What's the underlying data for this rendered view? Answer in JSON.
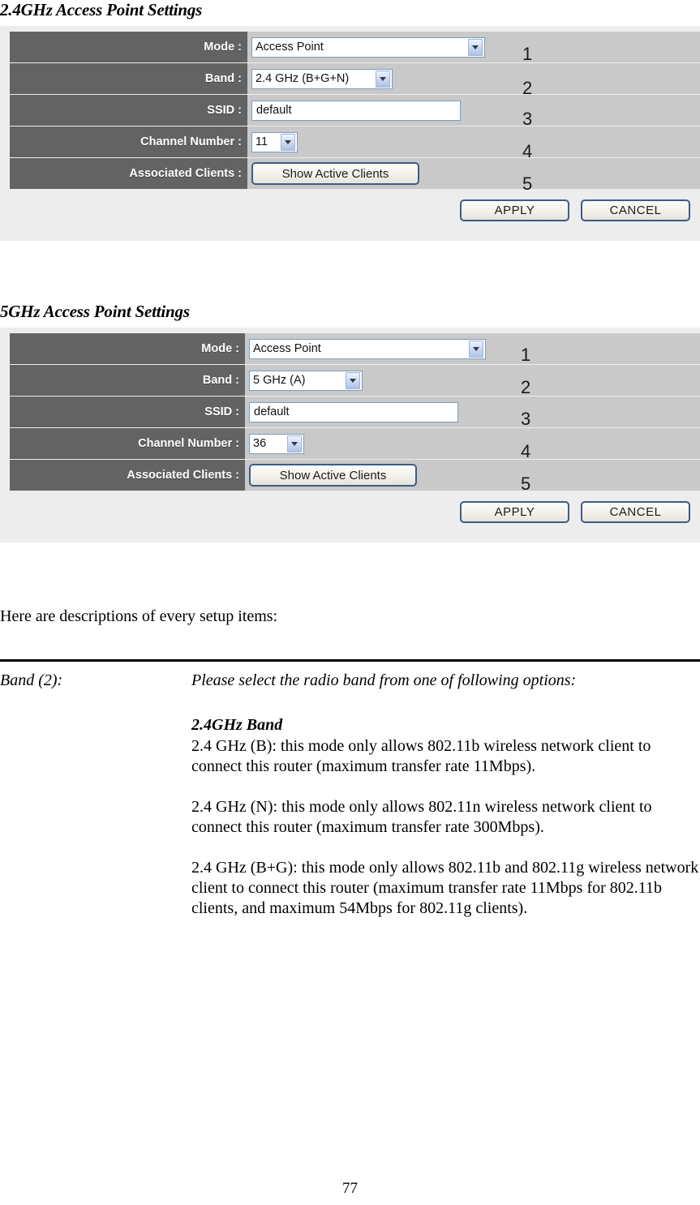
{
  "doc": {
    "page_number": "77"
  },
  "sections": [
    {
      "heading": "2.4GHz Access Point Settings",
      "rows": [
        {
          "label": "Mode :",
          "control": "select",
          "value": "Access Point",
          "num": "1"
        },
        {
          "label": "Band :",
          "control": "select",
          "value": "2.4 GHz (B+G+N)",
          "num": "2"
        },
        {
          "label": "SSID :",
          "control": "text",
          "value": "default",
          "num": "3"
        },
        {
          "label": "Channel Number :",
          "control": "select",
          "value": "11",
          "num": "4"
        },
        {
          "label": "Associated Clients :",
          "control": "button",
          "value": "Show Active Clients",
          "num": "5"
        }
      ],
      "apply_label": "APPLY",
      "cancel_label": "CANCEL"
    },
    {
      "heading": "5GHz Access Point Settings",
      "rows": [
        {
          "label": "Mode :",
          "control": "select",
          "value": "Access Point",
          "num": "1"
        },
        {
          "label": "Band :",
          "control": "select",
          "value": "5 GHz (A)",
          "num": "2"
        },
        {
          "label": "SSID :",
          "control": "text",
          "value": "default",
          "num": "3"
        },
        {
          "label": "Channel Number :",
          "control": "select",
          "value": "36",
          "num": "4"
        },
        {
          "label": "Associated Clients :",
          "control": "button",
          "value": "Show Active Clients",
          "num": "5"
        }
      ],
      "apply_label": "APPLY",
      "cancel_label": "CANCEL"
    }
  ],
  "body": {
    "intro": "Here are descriptions of every setup items:",
    "definition": {
      "term": "Band (2):",
      "lead": "Please select the radio band from one of following options:",
      "sub_heading": "2.4GHz Band",
      "paragraphs": [
        "2.4 GHz (B): this mode only allows 802.11b wireless network client to connect this router (maximum transfer rate 11Mbps).",
        "2.4 GHz (N): this mode only allows 802.11n wireless network client to connect this router (maximum transfer rate 300Mbps).",
        "2.4 GHz (B+G): this mode only allows 802.11b and 802.11g wireless network client to connect this router (maximum transfer rate 11Mbps for 802.11b clients, and maximum 54Mbps for 802.11g clients)."
      ]
    }
  },
  "colors": {
    "label_cell": "#636363",
    "field_cell": "#c9c9c9",
    "panel_bg": "#ededed",
    "button_border": "#3c5d86",
    "input_border": "#7b9ebd"
  }
}
